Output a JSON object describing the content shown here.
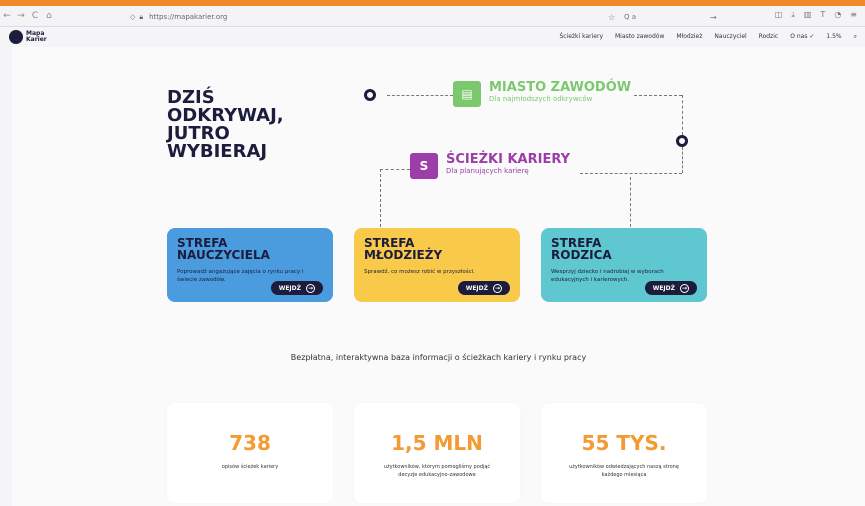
{
  "browser": {
    "url": "https://mapakarier.org",
    "search_text": "Q a"
  },
  "logo": {
    "line1": "Mapa",
    "line2": "Karier"
  },
  "menu": [
    "Ścieżki kariery",
    "Miasto zawodów",
    "Młodzież",
    "Nauczyciel",
    "Rodzic",
    "O nas ✓",
    "1.5%",
    "⌕"
  ],
  "hero": {
    "line1": "DZIŚ",
    "line2": "ODKRYWAJ,",
    "line3": "JUTRO",
    "line4": "WYBIERAJ"
  },
  "miasto": {
    "title": "MIASTO ZAWODÓW",
    "subtitle": "Dla najmłodszych odkrywców",
    "icon": "calculator-icon"
  },
  "sciezki": {
    "title": "ŚCIEŻKI KARIERY",
    "subtitle": "Dla planujących karierę",
    "icon": "path-icon"
  },
  "cards": [
    {
      "title1": "STREFA",
      "title2": "NAUCZYCIELA",
      "desc": "Poprowadź angażujące zajęcia o rynku pracy i świecie zawodów.",
      "button": "WEJDŹ",
      "color": "#4b9bdf"
    },
    {
      "title1": "STREFA",
      "title2": "MŁODZIEŻY",
      "desc": "Sprawdź, co możesz robić w przyszłości.",
      "button": "WEJDŹ",
      "color": "#f9c94a"
    },
    {
      "title1": "STREFA",
      "title2": "RODZICA",
      "desc": "Wesprzyj dziecko i nadrobiaj w wyborach edukacyjnych i karierowych.",
      "button": "WEJDŹ",
      "color": "#5fc7cf"
    }
  ],
  "tagline": "Bezpłatna, interaktywna baza informacji o ścieżkach kariery i rynku pracy",
  "stats": [
    {
      "value": "738",
      "label": "opisów ścieżek kariery"
    },
    {
      "value": "1,5 MLN",
      "label": "użytkowników, którym pomogliśmy podjąć decyzje edukacyjno-zawodowe"
    },
    {
      "value": "55 TYS.",
      "label": "użytkowników odwiedzających naszą stronę każdego miesiąca"
    }
  ],
  "colors": {
    "orange": "#f39a33",
    "dark": "#1c1c3c",
    "green": "#7cc86e",
    "purple": "#9b3ea8",
    "red": "#e8294b"
  }
}
